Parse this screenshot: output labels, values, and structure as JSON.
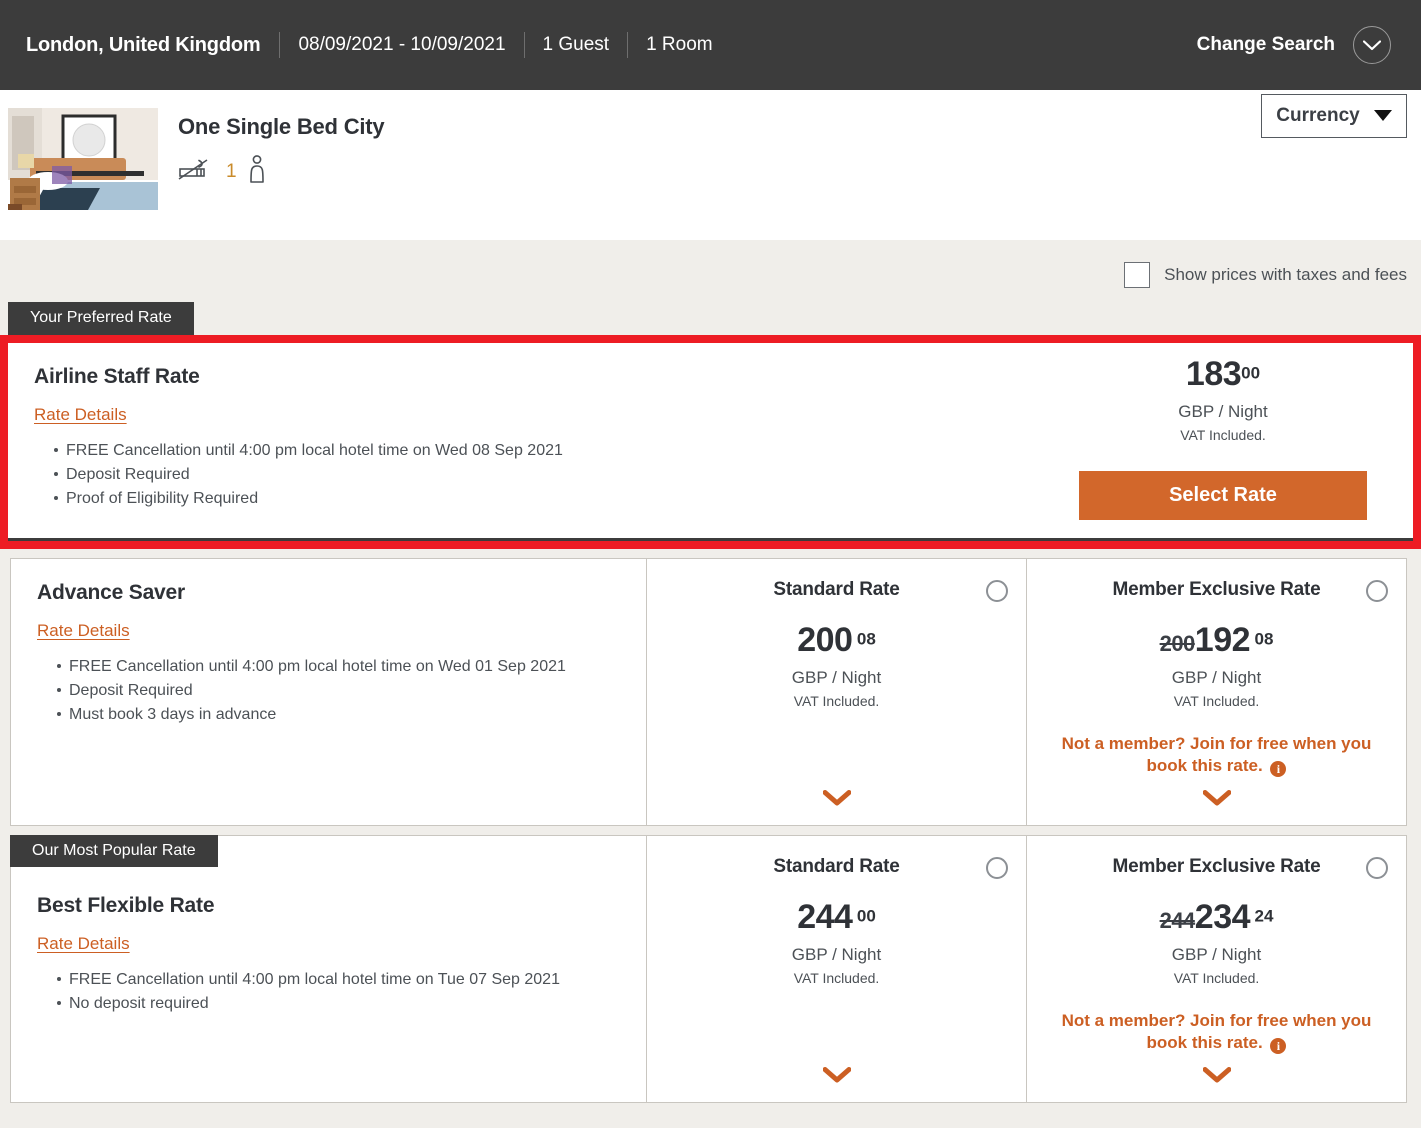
{
  "search_bar": {
    "destination": "London, United Kingdom",
    "dates": "08/09/2021 - 10/09/2021",
    "guests": "1 Guest",
    "rooms": "1 Room",
    "change_search_label": "Change Search",
    "chevron_icon": "chevron-down-icon"
  },
  "room_header": {
    "title": "One Single Bed City",
    "smoking_icon": "no-smoking-icon",
    "occupancy_count": "1",
    "guest_icon": "person-icon",
    "currency_label": "Currency",
    "currency_caret_icon": "caret-down-icon"
  },
  "options": {
    "show_taxes_label": "Show prices with taxes and fees",
    "show_taxes_checked": false
  },
  "colors": {
    "accent_orange": "#d2672b",
    "link_orange": "#cc5f23",
    "highlight_red": "#ed1c24",
    "dark": "#3c3c3c",
    "page_bg": "#f0eeea"
  },
  "preferred_rate": {
    "tag": "Your Preferred Rate",
    "name": "Airline Staff Rate",
    "rate_details_label": "Rate Details",
    "bullets": [
      "FREE Cancellation until 4:00 pm local hotel time on Wed 08 Sep 2021",
      "Deposit Required",
      "Proof of Eligibility Required"
    ],
    "price_whole": "183",
    "price_cents": "00",
    "per_night": "GBP / Night",
    "vat": "VAT Included.",
    "select_label": "Select Rate"
  },
  "rate_cards": [
    {
      "name": "Advance Saver",
      "rate_details_label": "Rate Details",
      "bullets": [
        "FREE Cancellation until 4:00 pm local hotel time on Wed 01 Sep 2021",
        "Deposit Required",
        "Must book 3 days in advance"
      ],
      "standard": {
        "title": "Standard Rate",
        "price_whole": "200",
        "price_cents": "08",
        "per_night": "GBP / Night",
        "vat": "VAT Included.",
        "expand_icon": "chevron-down-icon"
      },
      "member": {
        "title": "Member Exclusive Rate",
        "price_old": "200",
        "price_whole": "192",
        "price_cents": "08",
        "per_night": "GBP / Night",
        "vat": "VAT Included.",
        "promo": "Not a member? Join for free when you book this rate.",
        "promo_info_icon": "info-icon",
        "expand_icon": "chevron-down-icon"
      }
    },
    {
      "tag": "Our Most Popular Rate",
      "name": "Best Flexible Rate",
      "rate_details_label": "Rate Details",
      "bullets": [
        "FREE Cancellation until 4:00 pm local hotel time on Tue 07 Sep 2021",
        "No deposit required"
      ],
      "standard": {
        "title": "Standard Rate",
        "price_whole": "244",
        "price_cents": "00",
        "per_night": "GBP / Night",
        "vat": "VAT Included.",
        "expand_icon": "chevron-down-icon"
      },
      "member": {
        "title": "Member Exclusive Rate",
        "price_old": "244",
        "price_whole": "234",
        "price_cents": "24",
        "per_night": "GBP / Night",
        "vat": "VAT Included.",
        "promo": "Not a member? Join for free when you book this rate.",
        "promo_info_icon": "info-icon",
        "expand_icon": "chevron-down-icon"
      }
    }
  ]
}
